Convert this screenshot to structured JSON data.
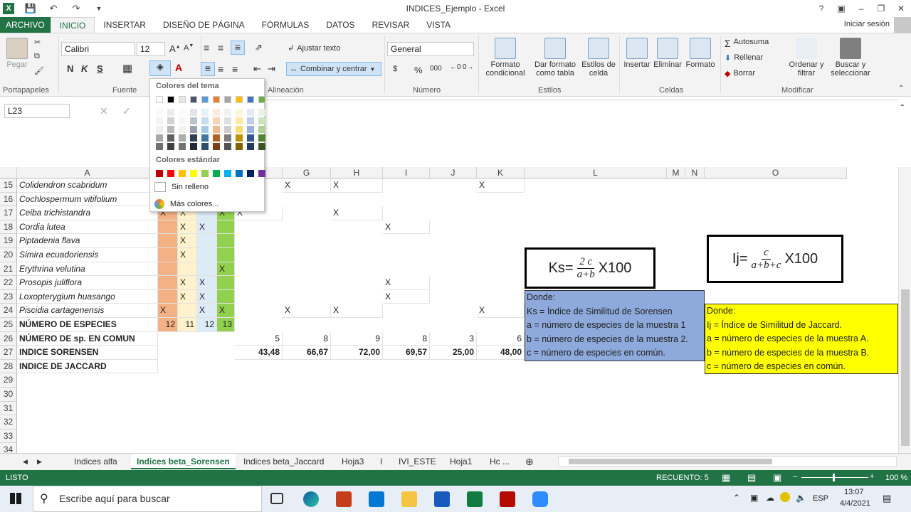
{
  "app": {
    "title": "INDICES_Ejemplo - Excel",
    "signin": "Iniciar sesión",
    "help": "?"
  },
  "tabs": [
    "ARCHIVO",
    "INICIO",
    "INSERTAR",
    "DISEÑO DE PÁGINA",
    "FÓRMULAS",
    "DATOS",
    "REVISAR",
    "VISTA"
  ],
  "ribbon": {
    "clipboard": {
      "paste": "Pegar",
      "label": "Portapapeles"
    },
    "font": {
      "name": "Calibri",
      "size": "12",
      "bold": "N",
      "italic": "K",
      "underline": "S",
      "label": "Fuente"
    },
    "alignment": {
      "wrap": "Ajustar texto",
      "merge": "Combinar y centrar",
      "label": "Alineación"
    },
    "number": {
      "format": "General",
      "currency": "$",
      "percent": "%",
      "thousands": "000",
      "label": "Número"
    },
    "styles": {
      "cond": "Formato condicional",
      "table": "Dar formato como tabla",
      "cell": "Estilos de celda",
      "label": "Estilos"
    },
    "cells": {
      "insert": "Insertar",
      "delete": "Eliminar",
      "format": "Formato",
      "label": "Celdas"
    },
    "editing": {
      "autosum": "Autosuma",
      "fill": "Rellenar",
      "clear": "Borrar",
      "sort": "Ordenar y filtrar",
      "find": "Buscar y seleccionar",
      "label": "Modificar"
    }
  },
  "namebox": "L23",
  "colorpicker": {
    "theme_title": "Colores del tema",
    "standard_title": "Colores estándar",
    "no_fill": "Sin relleno",
    "more": "Más colores...",
    "theme_top": [
      "#ffffff",
      "#000000",
      "#e7e6e6",
      "#44546a",
      "#5b9bd5",
      "#ed7d31",
      "#a5a5a5",
      "#ffc000",
      "#4472c4",
      "#70ad47"
    ],
    "standard": [
      "#c00000",
      "#ff0000",
      "#ffc000",
      "#ffff00",
      "#92d050",
      "#00b050",
      "#00b0f0",
      "#0070c0",
      "#002060",
      "#7030a0"
    ]
  },
  "columns": [
    "A",
    "B",
    "C",
    "D",
    "E",
    "F",
    "G",
    "H",
    "I",
    "J",
    "K",
    "L",
    "M",
    "N",
    "O"
  ],
  "rows": [
    "15",
    "16",
    "17",
    "18",
    "19",
    "20",
    "21",
    "22",
    "23",
    "24",
    "25",
    "26",
    "27",
    "28",
    "29",
    "30",
    "31",
    "32",
    "33",
    "34"
  ],
  "species": [
    "Colidendron scabridum",
    "Cochlospermum vitifolium",
    "Ceiba trichistandra",
    "Cordia lutea",
    "Piptadenia flava",
    "Simira ecuadoriensis",
    "Erythrina velutina",
    "Prosopis juliflora",
    "Loxopterygium huasango",
    "Piscidia cartagenensis"
  ],
  "labels": {
    "r25": "NÚMERO DE ESPECIES",
    "r26": "NÚMERO DE sp. EN COMUN",
    "r27": "INDICE SORENSEN",
    "r28": "INDICE DE JACCARD"
  },
  "r25_vals": [
    "12",
    "11",
    "12",
    "13"
  ],
  "r26_vals": [
    "5",
    "8",
    "9",
    "8",
    "3",
    "6"
  ],
  "r27_vals": [
    "43,48",
    "66,67",
    "72,00",
    "69,57",
    "25,00",
    "48,00"
  ],
  "mark": "X",
  "sorensen": {
    "lhs": "Ks=",
    "num": "2 c",
    "den": "a+b",
    "rhs": "X100",
    "donde": "Donde:",
    "l1": "Ks = Índice de Similitud de Sorensen",
    "l2": "a = número de especies de la muestra 1",
    "l3": "b = número de especies de la muestra 2.",
    "l4": "c = número de especies en común."
  },
  "jaccard": {
    "lhs": "Ij=",
    "num": "c",
    "den": "a+b+c",
    "rhs": "X100",
    "donde": "Donde:",
    "l1": "Ij = Índice de Similitud de Jaccard.",
    "l2": "a = número de especies de la muestra A.",
    "l3": "b = número de especies de la muestra B.",
    "l4": "c = número de especies en común."
  },
  "sheets": [
    "Indices alfa",
    "Indices beta_Sorensen",
    "Indices beta_Jaccard",
    "Hoja3",
    "I",
    "IVI_ESTE",
    "Hoja1",
    "Hc ..."
  ],
  "status": {
    "ready": "LISTO",
    "count": "RECUENTO: 5",
    "zoom": "100 %"
  },
  "taskbar": {
    "search": "Escribe aquí para buscar",
    "lang": "ESP",
    "time": "13:07",
    "date": "4/4/2021"
  },
  "colors": {
    "excel_green": "#217346",
    "orange": "#f4b183",
    "light_yellow": "#fff2cc",
    "light_blue": "#ddebf7",
    "green": "#92d050",
    "blue_box": "#8ea9db",
    "yellow": "#ffff00"
  }
}
